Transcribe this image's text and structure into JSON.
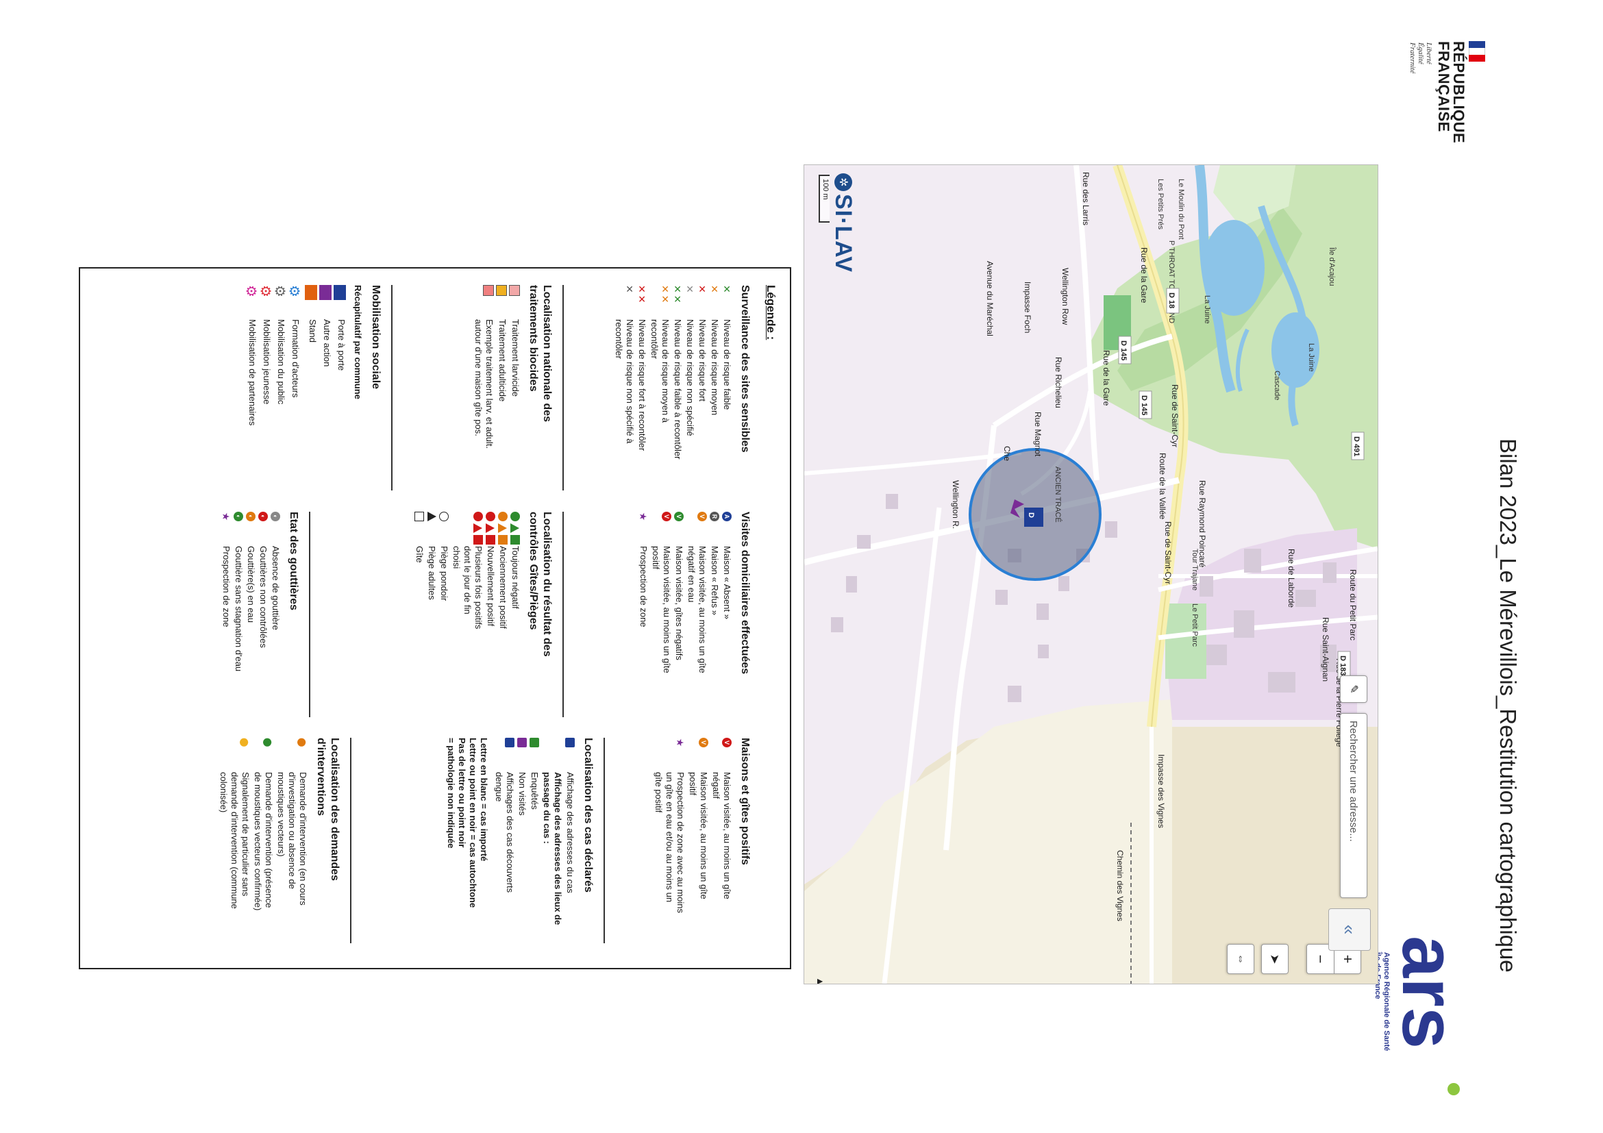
{
  "header": {
    "republic": [
      "RÉPUBLIQUE",
      "FRANÇAISE"
    ],
    "motto": [
      "Liberté",
      "Égalité",
      "Fraternité"
    ],
    "title": "Bilan 2023_Le Mérevillois_Restitution cartographique",
    "ars_logo": "ars",
    "ars_sub": [
      "Agence Régionale de Santé",
      "Île-de-France"
    ]
  },
  "map": {
    "search_placeholder": "Rechercher une adresse...",
    "zoom_in": "+",
    "zoom_out": "−",
    "scale": "100 m",
    "brand": "SI·LAV",
    "labels": {
      "juine": "La Juine",
      "lajuine_north": "La Juine",
      "ile_acajou": "Île d'Acajou",
      "cascade": "Cascade",
      "moulin": "Le Moulin du Pont",
      "petits_pres": "Les Petits Prés",
      "throat": "P THROAT TOWNSEND",
      "petit_parc": "Le Petit Parc",
      "tour_trajane": "Tour Trajane",
      "rue_larris": "Rue des Larris",
      "rue_gare": "Rue de la Gare",
      "rue_gare_2": "Rue de la Gare",
      "rue_st_cyr": "Rue de Saint-Cyr",
      "rue_st_cyr_2": "Rue de Saint-Cyr",
      "rue_vallee": "Route de la Vallée",
      "rue_richelieu": "Rue Richelieu",
      "rue_magnot": "Rue Magnot",
      "wellington_row": "Wellington Row",
      "wellington_r": "Wellington R.",
      "impasse_foch": "Impasse Foch",
      "avenue_marechal": "Avenue du Maréchal",
      "rue_raymond": "Rue Raymond Poincaré",
      "rue_laborde": "Rue de Laborde",
      "rue_saint_aignan": "Rue Saint-Aignan",
      "rue_pierre_follege": "Rue de la Pierre Follège",
      "route_petit_parc": "Route du Petit Parc",
      "impasse_vignes": "Impasse des Vignes",
      "chemin_vignes": "Chemin des Vignes",
      "d491": "D 491",
      "d145": "D 145",
      "d183": "D 183",
      "d18": "D 18",
      "d145b": "D 145",
      "ancien_throat": "ANCIEN TRACÉ",
      "ch": "Che"
    },
    "case_marker": "D"
  },
  "legend": {
    "title": "Légende :",
    "surveillance": {
      "heading": "Surveillance des sites sensibles",
      "items": [
        {
          "label": [
            "Niveau de risque faible"
          ],
          "colors": [
            "#2e8b2e"
          ]
        },
        {
          "label": [
            "Niveau de risque moyen"
          ],
          "colors": [
            "#e07a10"
          ]
        },
        {
          "label": [
            "Niveau de risque fort"
          ],
          "colors": [
            "#d01818"
          ]
        },
        {
          "label": [
            "Niveau de risque non spécifié"
          ],
          "colors": [
            "#888888"
          ]
        },
        {
          "label": [
            "Niveau de risque faible à recontôler"
          ],
          "colors": [
            "#2e8b2e",
            "#2e8b2e"
          ]
        },
        {
          "label": [
            "Niveau de risque moyen à",
            "recontôler"
          ],
          "colors": [
            "#e07a10",
            "#e07a10"
          ]
        },
        {
          "label": [
            "Niveau de risque fort à recontôler"
          ],
          "colors": [
            "#d01818",
            "#d01818"
          ]
        },
        {
          "label": [
            "Niveau de risque non spécifié à",
            "recontôler"
          ],
          "colors": [
            "#555555"
          ]
        }
      ]
    },
    "biocides": {
      "heading": [
        "Localisation nationale des",
        "traitements biocides"
      ],
      "items": [
        {
          "label": [
            "Traitement larvicide"
          ],
          "color": "#f2a8a8"
        },
        {
          "label": [
            "Traitement adulticide"
          ],
          "color": "#f0b020"
        },
        {
          "label": [
            "Exemple traitement larv. et adult.",
            "autour d'une maison gîte pos."
          ],
          "color": "#f08080"
        }
      ]
    },
    "mobilisation": {
      "heading": "Mobilisation sociale",
      "sub": "Récapitulatif par commune",
      "items": [
        {
          "label": "Porte à porte",
          "color": "#1f3f96"
        },
        {
          "label": "Autre action",
          "color": "#7a2c96"
        },
        {
          "label": "Stand",
          "color": "#e06010"
        }
      ],
      "gears": [
        {
          "label": "Formation d'acteurs",
          "color": "#2a7fd4"
        },
        {
          "label": "Mobilisation du public",
          "color": "#666666"
        },
        {
          "label": "Mobilisation jeunesse",
          "color": "#e0303a"
        },
        {
          "label": "Mobilisation de partenaires",
          "color": "#d02898"
        }
      ]
    },
    "visites": {
      "heading": "Visites domiciliaires effectuées",
      "items": [
        {
          "label": [
            "Maison « Absent »"
          ],
          "color": "#1f3f96",
          "mark": "A"
        },
        {
          "label": [
            "Maison « Refus »"
          ],
          "color": "#555555",
          "mark": "R"
        },
        {
          "label": [
            "Maison visitée, au moins un gîte",
            "négatif en eau"
          ],
          "color": "#e07a10",
          "mark": "V"
        },
        {
          "label": [
            "Maison visitée, gîtes négatifs"
          ],
          "color": "#2e8b2e",
          "mark": "V"
        },
        {
          "label": [
            "Maison visitée, au moins un gîte",
            "positif"
          ],
          "color": "#d01818",
          "mark": "V"
        },
        {
          "label": [
            "Prospection de zone"
          ],
          "color": "#7a2c96",
          "mark": "★"
        }
      ]
    },
    "controles": {
      "heading": [
        "Localisation du résultat des",
        "contrôles Gîtes/Pièges"
      ],
      "items": [
        {
          "label": [
            "Toujours négatif"
          ],
          "color": "#2e8b2e"
        },
        {
          "label": [
            "Anciennement positif"
          ],
          "color": "#e07a10"
        },
        {
          "label": [
            "Nouvellement positif"
          ],
          "color": "#d01818"
        },
        {
          "label": [
            "Plusieurs fois positifs",
            "dont le jour de fin",
            "choisi"
          ],
          "color": "#d01818"
        },
        {
          "label": [
            "Piège pondoir"
          ],
          "color": "#ffffff"
        },
        {
          "label": [
            "Piège adultes"
          ],
          "color": "#ffffff"
        },
        {
          "label": [
            "Gîte"
          ],
          "color": "#ffffff"
        }
      ]
    },
    "gouttieres": {
      "heading": "Etat des gouttières",
      "items": [
        {
          "label": [
            "Absence de gouttière"
          ],
          "color": "#888888"
        },
        {
          "label": [
            "Gouttières non contrôlées"
          ],
          "color": "#d01818"
        },
        {
          "label": [
            "Gouttière(s) en eau"
          ],
          "color": "#e07a10"
        },
        {
          "label": [
            "Gouttière sans stagnation d'eau"
          ],
          "color": "#2e8b2e"
        },
        {
          "label": [
            "Prospection de zone"
          ],
          "color": "#7a2c96"
        }
      ]
    },
    "positifs": {
      "heading": "Maisons et gîtes positifs",
      "items": [
        {
          "label": [
            "Maison visitée, au moins un gîte",
            "négatif"
          ],
          "color": "#d01818"
        },
        {
          "label": [
            "Maison visitée, au moins un gîte",
            "positif"
          ],
          "color": "#e07a10"
        },
        {
          "label": [
            "Prospection de zone avec au moins",
            "un gîte en eau et/ou au moins un",
            "gîte positif"
          ],
          "color": "#7a2c96"
        }
      ]
    },
    "cas": {
      "heading": "Localisation des cas déclarés",
      "items": [
        {
          "label": [
            "Affichage des adresses du cas"
          ],
          "color": "#1f3f96"
        },
        {
          "label": [
            "Affichage des adresses des lieux de",
            "passage du cas :"
          ],
          "color": "",
          "bold": true
        },
        {
          "label": [
            "Enquêtés"
          ],
          "color": "#2e8b2e"
        },
        {
          "label": [
            "Non visités"
          ],
          "color": "#7a2c96"
        },
        {
          "label": [
            "Affichages des cas découverts",
            "dengue"
          ],
          "color": "#1f3f96"
        }
      ],
      "notes": [
        "Lettre en blanc = cas importé",
        "Lettre ou point en noir = cas autochtone",
        "Pas de lettre ou point noir",
        "= pathologie non indiquée"
      ]
    },
    "demandes": {
      "heading": [
        "Localisation des demandes",
        "d'interventions"
      ],
      "items": [
        {
          "label": [
            "Demande d'intervention (en cours",
            "d'investigation ou absence de",
            "moustiques vecteurs)"
          ],
          "color": "#e07a10"
        },
        {
          "label": [
            "Demande d'intervention (présence",
            "de moustiques vecteurs confirmée)"
          ],
          "color": "#2e8b2e"
        },
        {
          "label": [
            "Signalement de particulier sans",
            "demande d'intervention (commune",
            "colonisée)"
          ],
          "color": "#f0b020"
        }
      ]
    }
  }
}
